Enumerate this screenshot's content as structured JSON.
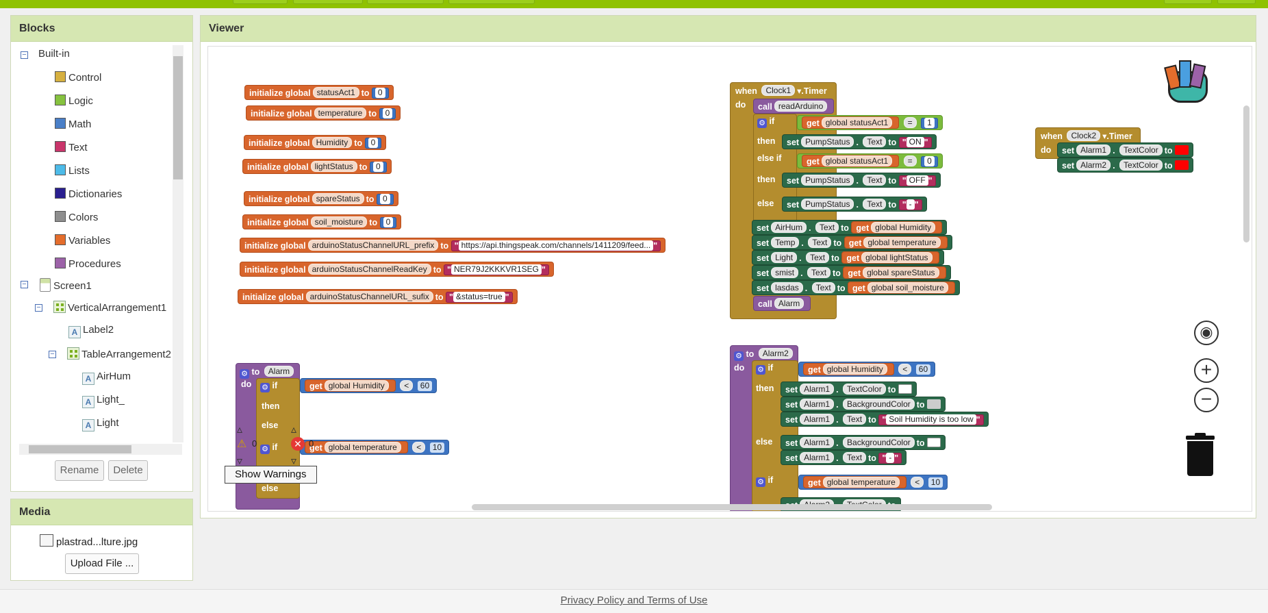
{
  "blocks_panel": {
    "title": "Blocks",
    "builtin_label": "Built-in",
    "categories": [
      {
        "label": "Control",
        "color": "#d6b040"
      },
      {
        "label": "Logic",
        "color": "#86c23f"
      },
      {
        "label": "Math",
        "color": "#4a7fc7"
      },
      {
        "label": "Text",
        "color": "#c9356b"
      },
      {
        "label": "Lists",
        "color": "#4dbbe8"
      },
      {
        "label": "Dictionaries",
        "color": "#2a1f8f"
      },
      {
        "label": "Colors",
        "color": "#8e8e8e"
      },
      {
        "label": "Variables",
        "color": "#e46d2c"
      },
      {
        "label": "Procedures",
        "color": "#9c62a8"
      }
    ],
    "components": {
      "screen": "Screen1",
      "vertical": "VerticalArrangement1",
      "label2": "Label2",
      "table": "TableArrangement2",
      "airhum": "AirHum",
      "light_": "Light_",
      "light": "Light"
    },
    "rename_label": "Rename",
    "delete_label": "Delete"
  },
  "media_panel": {
    "title": "Media",
    "file": "plastrad...lture.jpg",
    "upload_label": "Upload File ..."
  },
  "viewer": {
    "title": "Viewer",
    "show_warnings": "Show Warnings",
    "warning_count": "0",
    "error_count": "0"
  },
  "globals": [
    {
      "name": "statusAct1",
      "value": "0"
    },
    {
      "name": "temperature",
      "value": "0"
    },
    {
      "name": "Humidity",
      "value": "0"
    },
    {
      "name": "lightStatus",
      "value": "0"
    },
    {
      "name": "spareStatus",
      "value": "0"
    },
    {
      "name": "soil_moisture",
      "value": "0"
    },
    {
      "name": "arduinoStatusChannelURL_prefix",
      "value": "https://api.thingspeak.com/channels/1411209/feed..."
    },
    {
      "name": "arduinoStatusChannelReadKey",
      "value": "NER79J2KKKVR1SEG"
    },
    {
      "name": "arduinoStatusChannelURL_sufix",
      "value": "&status=true"
    }
  ],
  "kw": {
    "init": "initialize global",
    "to": "to",
    "when": "when",
    "do": "do",
    "call": "call",
    "if": "if",
    "then": "then",
    "else_if": "else if",
    "else": "else",
    "set": "set",
    "get": "get",
    "dot": ".",
    "timer": ".Timer",
    "quote": "\"",
    "arrow": "▾"
  },
  "clock1": {
    "component": "Clock1",
    "call_proc": "readArduino",
    "cond1_var": "global statusAct1",
    "cond1_op": "=",
    "cond1_val": "1",
    "pump": "PumpStatus",
    "text_prop": "Text",
    "on": "ON",
    "off": "OFF",
    "dash": "-",
    "cond2_val": "0",
    "sets": [
      {
        "comp": "AirHum",
        "var": "global Humidity"
      },
      {
        "comp": "Temp",
        "var": "global temperature"
      },
      {
        "comp": "Light",
        "var": "global lightStatus"
      },
      {
        "comp": "smist",
        "var": "global spareStatus"
      },
      {
        "comp": "lasdas",
        "var": "global soil_moisture"
      }
    ],
    "call_alarm": "Alarm"
  },
  "clock2": {
    "component": "Clock2",
    "alarm1": "Alarm1",
    "alarm2": "Alarm2",
    "prop": "TextColor",
    "color": "#ff0000"
  },
  "alarm_proc": {
    "name": "Alarm",
    "var1": "global Humidity",
    "op": "<",
    "val1": "60",
    "var2": "global temperature",
    "val2": "10"
  },
  "alarm2_proc": {
    "name": "Alarm2",
    "var1": "global Humidity",
    "op": "<",
    "val1": "60",
    "comp": "Alarm1",
    "textcolor": "TextColor",
    "bgcolor": "BackgroundColor",
    "text": "Text",
    "msg": "Soil Humidity is too low",
    "dash": "-",
    "var2": "global temperature",
    "val2": "10",
    "comp2": "Alarm2",
    "white": "#ffffff",
    "gray": "#cccccc"
  },
  "footer": {
    "link": "Privacy Policy and Terms of Use"
  }
}
